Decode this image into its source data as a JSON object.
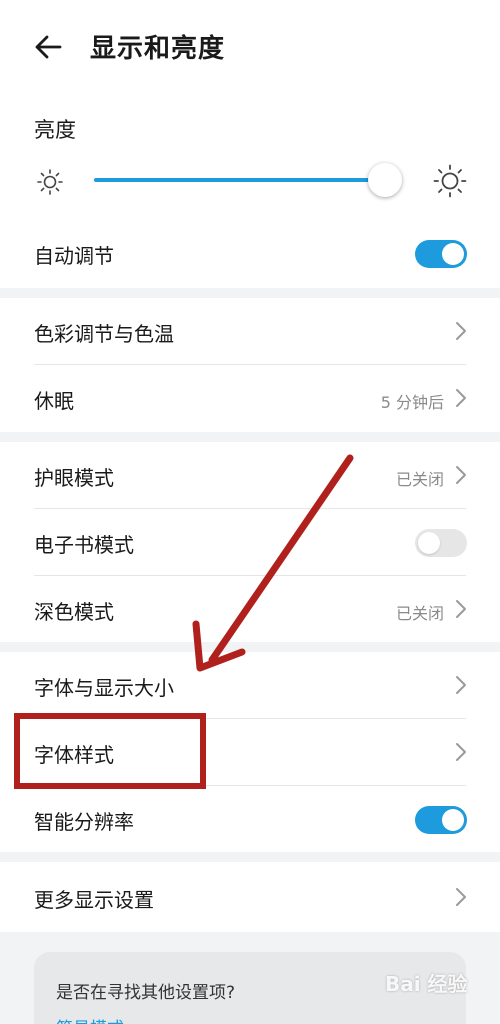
{
  "header": {
    "title": "显示和亮度",
    "back_icon": "back-arrow-icon"
  },
  "brightness": {
    "title": "亮度",
    "level_percent": 98,
    "min_icon": "sun-small-icon",
    "max_icon": "sun-large-icon",
    "accent_color": "#1e9bdc"
  },
  "auto_adjust": {
    "label": "自动调节",
    "enabled": true
  },
  "color_section": {
    "color_temp_label": "色彩调节与色温",
    "sleep_label": "休眠",
    "sleep_value": "5 分钟后"
  },
  "eye_section": {
    "eye_comfort_label": "护眼模式",
    "eye_comfort_value": "已关闭",
    "ebook_label": "电子书模式",
    "ebook_enabled": false,
    "dark_label": "深色模式",
    "dark_value": "已关闭"
  },
  "font_section": {
    "font_size_label": "字体与显示大小",
    "font_style_label": "字体样式",
    "smart_resolution_label": "智能分辨率",
    "smart_resolution_enabled": true
  },
  "more_section": {
    "more_label": "更多显示设置"
  },
  "search_suggestion": {
    "question": "是否在寻找其他设置项?",
    "link": "简易模式"
  },
  "annotation": {
    "color": "#b0201c"
  },
  "watermark": {
    "text": "Bai 经验"
  }
}
